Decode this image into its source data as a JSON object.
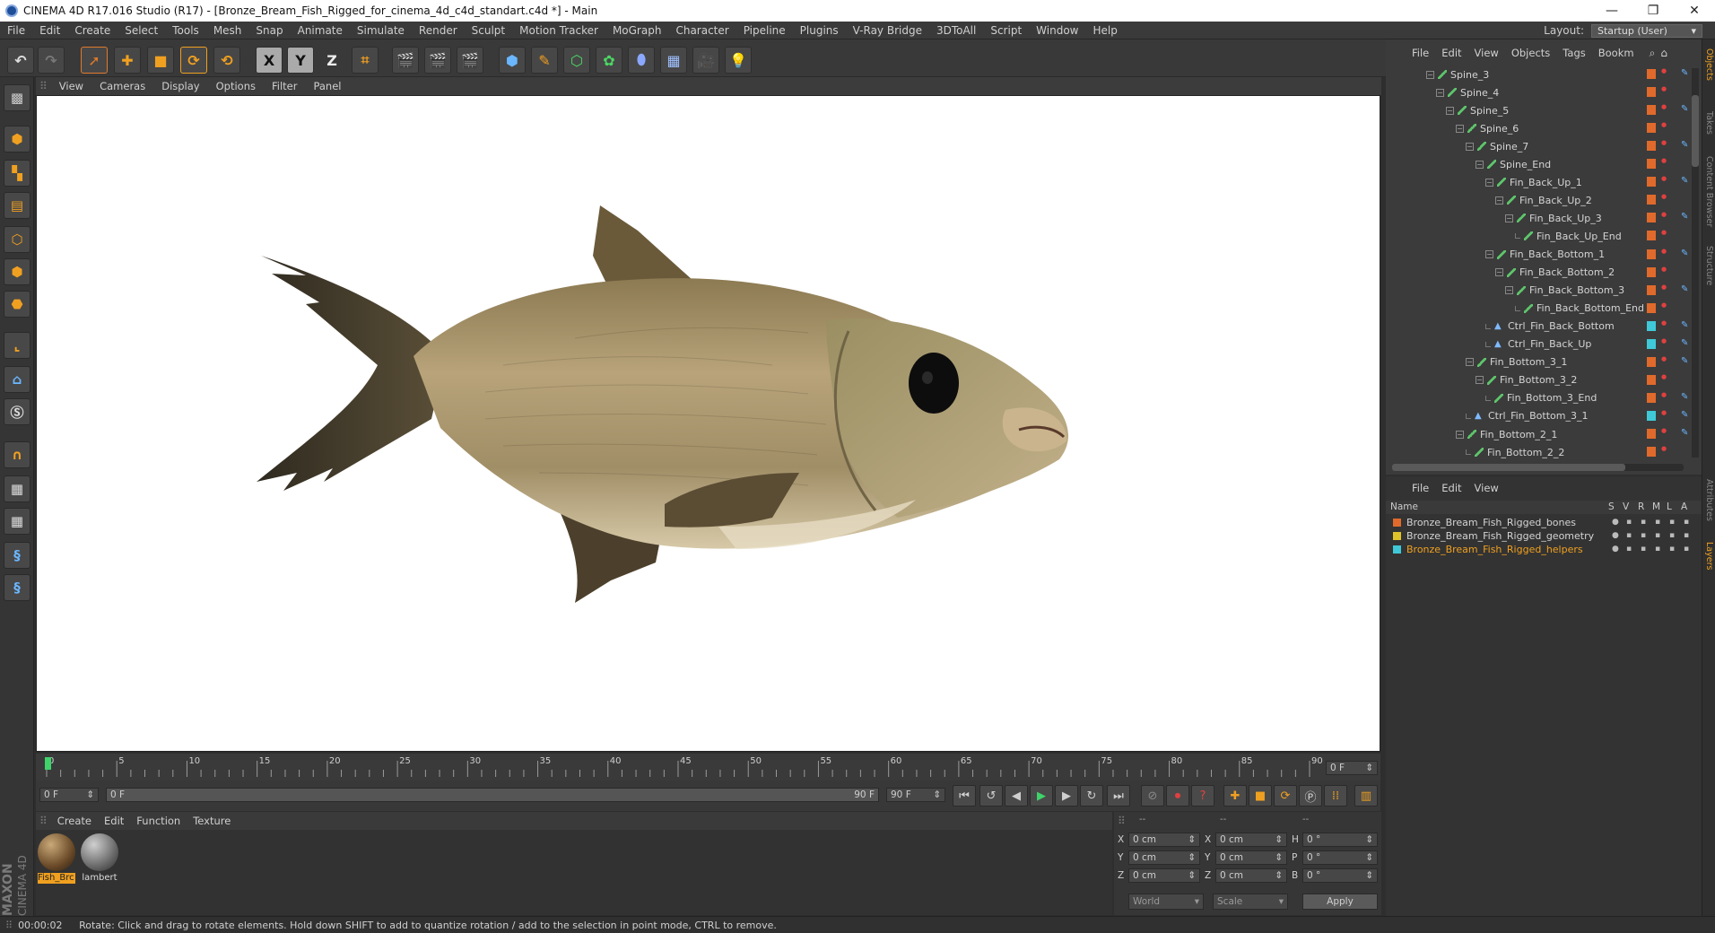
{
  "window": {
    "title": "CINEMA 4D R17.016 Studio (R17) - [Bronze_Bream_Fish_Rigged_for_cinema_4d_c4d_standart.c4d *] - Main",
    "minimize": "—",
    "restore": "❐",
    "close": "✕"
  },
  "menubar": {
    "items": [
      "File",
      "Edit",
      "Create",
      "Select",
      "Tools",
      "Mesh",
      "Snap",
      "Animate",
      "Simulate",
      "Render",
      "Sculpt",
      "Motion Tracker",
      "MoGraph",
      "Character",
      "Pipeline",
      "Plugins",
      "V-Ray Bridge",
      "3DToAll",
      "Script",
      "Window",
      "Help"
    ],
    "layout_label": "Layout:",
    "layout_value": "Startup (User)"
  },
  "toolbar": {
    "x_label": "X",
    "y_label": "Y",
    "z_label": "Z"
  },
  "viewport": {
    "menu": [
      "View",
      "Cameras",
      "Display",
      "Options",
      "Filter",
      "Panel"
    ]
  },
  "timeline": {
    "ticks": [
      "0",
      "5",
      "10",
      "15",
      "20",
      "25",
      "30",
      "35",
      "40",
      "45",
      "50",
      "55",
      "60",
      "65",
      "70",
      "75",
      "80",
      "85",
      "90"
    ],
    "current_frame": "0 F",
    "start_field": "0 F",
    "range_start": "0 F",
    "range_end": "90 F",
    "end_field": "90 F"
  },
  "material_manager": {
    "menu": [
      "Create",
      "Edit",
      "Function",
      "Texture"
    ],
    "materials": [
      {
        "name": "Fish_Brc",
        "selected": true
      },
      {
        "name": "lambert",
        "selected": false
      }
    ]
  },
  "coordinates": {
    "headers": [
      "--",
      "--",
      "--"
    ],
    "rows": [
      {
        "a": "X",
        "av": "0 cm",
        "b": "X",
        "bv": "0 cm",
        "c": "H",
        "cv": "0 °"
      },
      {
        "a": "Y",
        "av": "0 cm",
        "b": "Y",
        "bv": "0 cm",
        "c": "P",
        "cv": "0 °"
      },
      {
        "a": "Z",
        "av": "0 cm",
        "b": "Z",
        "bv": "0 cm",
        "c": "B",
        "cv": "0 °"
      }
    ],
    "mode": "World",
    "scale": "Scale",
    "apply": "Apply"
  },
  "object_manager": {
    "menu": [
      "File",
      "Edit",
      "View",
      "Objects",
      "Tags",
      "Bookm"
    ],
    "tree": [
      {
        "name": "Spine_3",
        "kind": "bone",
        "depth": 0,
        "tag": "#e06a2b"
      },
      {
        "name": "Spine_4",
        "kind": "bone",
        "depth": 1,
        "tag": "#e06a2b"
      },
      {
        "name": "Spine_5",
        "kind": "bone",
        "depth": 2,
        "tag": "#e06a2b"
      },
      {
        "name": "Spine_6",
        "kind": "bone",
        "depth": 3,
        "tag": "#e06a2b"
      },
      {
        "name": "Spine_7",
        "kind": "bone",
        "depth": 4,
        "tag": "#e06a2b"
      },
      {
        "name": "Spine_End",
        "kind": "bone",
        "depth": 5,
        "tag": "#e06a2b"
      },
      {
        "name": "Fin_Back_Up_1",
        "kind": "bone",
        "depth": 6,
        "tag": "#e06a2b"
      },
      {
        "name": "Fin_Back_Up_2",
        "kind": "bone",
        "depth": 7,
        "tag": "#e06a2b"
      },
      {
        "name": "Fin_Back_Up_3",
        "kind": "bone",
        "depth": 8,
        "tag": "#e06a2b"
      },
      {
        "name": "Fin_Back_Up_End",
        "kind": "bone",
        "depth": 9,
        "tag": "#e06a2b"
      },
      {
        "name": "Fin_Back_Bottom_1",
        "kind": "bone",
        "depth": 6,
        "tag": "#e06a2b"
      },
      {
        "name": "Fin_Back_Bottom_2",
        "kind": "bone",
        "depth": 7,
        "tag": "#e06a2b"
      },
      {
        "name": "Fin_Back_Bottom_3",
        "kind": "bone",
        "depth": 8,
        "tag": "#e06a2b"
      },
      {
        "name": "Fin_Back_Bottom_End",
        "kind": "bone",
        "depth": 9,
        "tag": "#e06a2b"
      },
      {
        "name": "Ctrl_Fin_Back_Bottom",
        "kind": "ctrl",
        "depth": 6,
        "tag": "#3fc9d8"
      },
      {
        "name": "Ctrl_Fin_Back_Up",
        "kind": "ctrl",
        "depth": 6,
        "tag": "#3fc9d8"
      },
      {
        "name": "Fin_Bottom_3_1",
        "kind": "bone",
        "depth": 4,
        "tag": "#e06a2b"
      },
      {
        "name": "Fin_Bottom_3_2",
        "kind": "bone",
        "depth": 5,
        "tag": "#e06a2b"
      },
      {
        "name": "Fin_Bottom_3_End",
        "kind": "bone",
        "depth": 6,
        "tag": "#e06a2b"
      },
      {
        "name": "Ctrl_Fin_Bottom_3_1",
        "kind": "ctrl",
        "depth": 4,
        "tag": "#3fc9d8"
      },
      {
        "name": "Fin_Bottom_2_1",
        "kind": "bone",
        "depth": 3,
        "tag": "#e06a2b"
      },
      {
        "name": "Fin_Bottom_2_2",
        "kind": "bone",
        "depth": 4,
        "tag": "#e06a2b"
      }
    ]
  },
  "layer_manager": {
    "menu": [
      "File",
      "Edit",
      "View"
    ],
    "columns": [
      "Name",
      "S",
      "V",
      "R",
      "M",
      "L",
      "A"
    ],
    "layers": [
      {
        "name": "Bronze_Bream_Fish_Rigged_bones",
        "color": "#e06a2b",
        "highlight": false
      },
      {
        "name": "Bronze_Bream_Fish_Rigged_geometry",
        "color": "#e0c32b",
        "highlight": false
      },
      {
        "name": "Bronze_Bream_Fish_Rigged_helpers",
        "color": "#3fc9d8",
        "highlight": true
      }
    ]
  },
  "side_tabs": [
    "Objects",
    "Takes",
    "Content Browser",
    "Structure",
    "Attributes",
    "Layers"
  ],
  "branding": {
    "maxon": "MAXON",
    "cinema": "CINEMA 4D"
  },
  "status": {
    "time": "00:00:02",
    "message": "Rotate: Click and drag to rotate elements. Hold down SHIFT to add to quantize rotation / add to the selection in point mode, CTRL to remove."
  }
}
